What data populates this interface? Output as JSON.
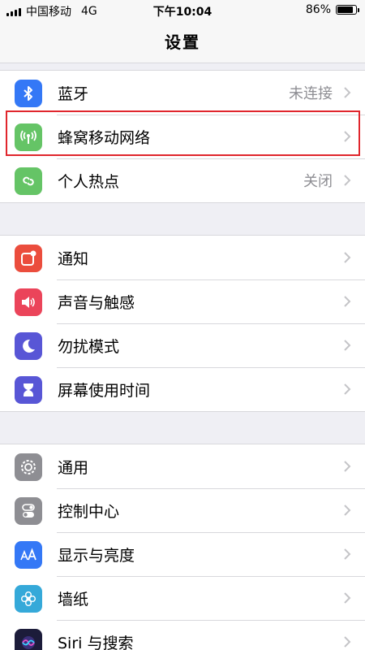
{
  "status_bar": {
    "carrier": "中国移动",
    "network": "4G",
    "time": "下午10:04",
    "battery_text": "86%",
    "battery_level": 0.86
  },
  "nav": {
    "title": "设置"
  },
  "groups": [
    {
      "items": [
        {
          "label": "蓝牙",
          "value": "未连接",
          "icon": "bluetooth-icon",
          "color": "#3478f6"
        },
        {
          "label": "蜂窝移动网络",
          "value": "",
          "icon": "cellular-antenna-icon",
          "color": "#65c466"
        },
        {
          "label": "个人热点",
          "value": "关闭",
          "icon": "personal-hotspot-icon",
          "color": "#65c466"
        }
      ]
    },
    {
      "items": [
        {
          "label": "通知",
          "icon": "notifications-icon",
          "color": "#eb4d3d"
        },
        {
          "label": "声音与触感",
          "icon": "speaker-icon",
          "color": "#eb445a"
        },
        {
          "label": "勿扰模式",
          "icon": "moon-icon",
          "color": "#5856d6"
        },
        {
          "label": "屏幕使用时间",
          "icon": "hourglass-icon",
          "color": "#5856d6"
        }
      ]
    },
    {
      "items": [
        {
          "label": "通用",
          "icon": "gear-icon",
          "color": "#8e8e93"
        },
        {
          "label": "控制中心",
          "icon": "toggles-icon",
          "color": "#8e8e93"
        },
        {
          "label": "显示与亮度",
          "icon": "text-size-icon",
          "color": "#3478f6"
        },
        {
          "label": "墙纸",
          "icon": "flower-icon",
          "color": "#35a9d9"
        },
        {
          "label": "Siri 与搜索",
          "icon": "siri-icon",
          "color": "#1c1c3a"
        }
      ]
    }
  ],
  "highlight_color": "#e0262d"
}
